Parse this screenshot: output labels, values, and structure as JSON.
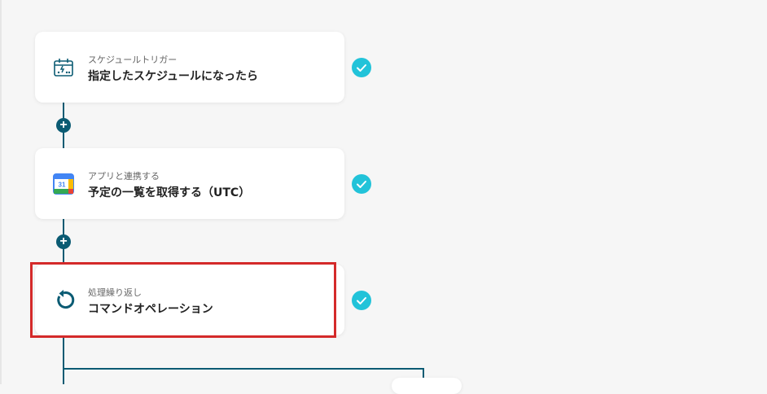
{
  "flow": {
    "steps": [
      {
        "label": "スケジュールトリガー",
        "title": "指定したスケジュールになったら",
        "icon": "schedule-trigger-icon",
        "status": "completed"
      },
      {
        "label": "アプリと連携する",
        "title": "予定の一覧を取得する（UTC）",
        "icon": "google-calendar-icon",
        "icon_text": "31",
        "status": "completed"
      },
      {
        "label": "処理繰り返し",
        "title": "コマンドオペレーション",
        "icon": "loop-arrow-icon",
        "status": "completed",
        "highlighted": true
      }
    ],
    "add_step_symbol": "+"
  },
  "colors": {
    "connector": "#0b5b73",
    "check": "#22c3d9",
    "highlight": "#d42a2a",
    "background": "#f6f6f6"
  }
}
